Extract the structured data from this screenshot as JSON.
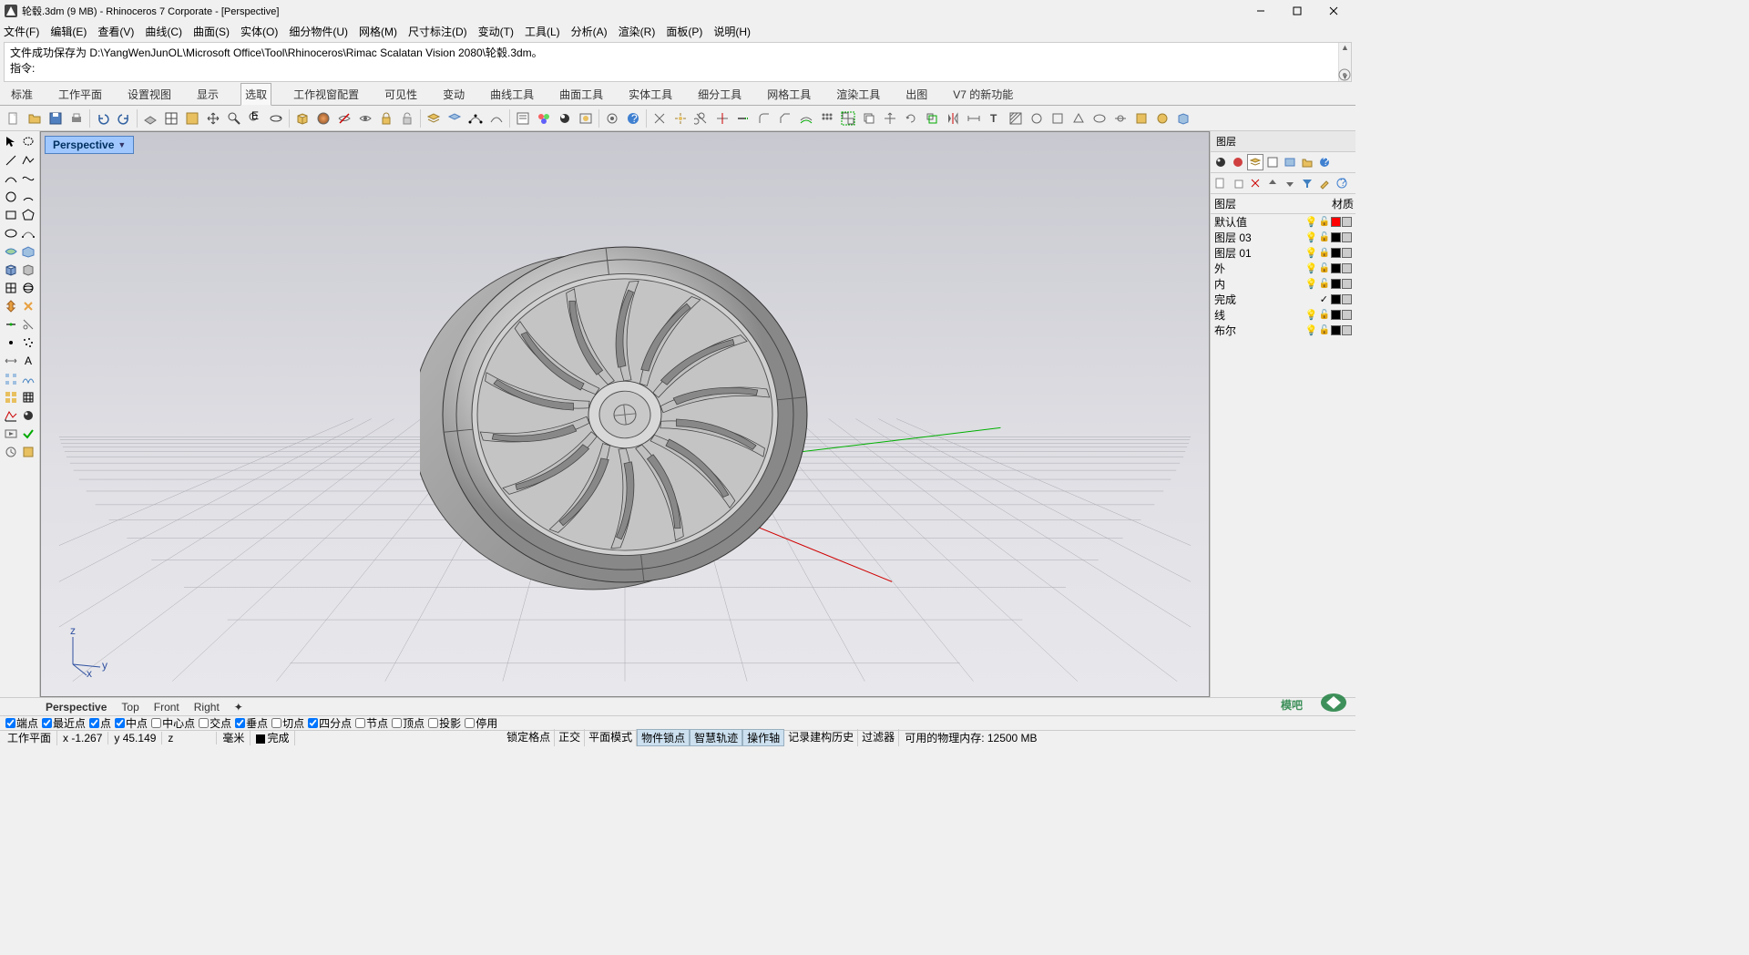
{
  "window": {
    "title": "轮毂.3dm (9 MB) - Rhinoceros 7 Corporate - [Perspective]"
  },
  "menu": [
    "文件(F)",
    "编辑(E)",
    "查看(V)",
    "曲线(C)",
    "曲面(S)",
    "实体(O)",
    "细分物件(U)",
    "网格(M)",
    "尺寸标注(D)",
    "变动(T)",
    "工具(L)",
    "分析(A)",
    "渲染(R)",
    "面板(P)",
    "说明(H)"
  ],
  "cmd": {
    "line1": "",
    "line2": "文件成功保存为 D:\\YangWenJunOL\\Microsoft Office\\Tool\\Rhinoceros\\Rimac Scalatan Vision 2080\\轮毂.3dm。",
    "prompt": "指令:"
  },
  "tabs": [
    "标准",
    "工作平面",
    "设置视图",
    "显示",
    "选取",
    "工作视窗配置",
    "可见性",
    "变动",
    "曲线工具",
    "曲面工具",
    "实体工具",
    "细分工具",
    "网格工具",
    "渲染工具",
    "出图",
    "V7 的新功能"
  ],
  "tabs_active": 4,
  "viewport": {
    "name": "Perspective"
  },
  "layerspanel": {
    "title": "图层",
    "header_name": "图层",
    "header_mat": "材质"
  },
  "layers": [
    {
      "name": "默认值",
      "on": true,
      "lock": true,
      "color": "#ff0000"
    },
    {
      "name": "图层 03",
      "on": true,
      "lock": true,
      "color": "#000000"
    },
    {
      "name": "图层 01",
      "on": true,
      "lock": true,
      "locked": true,
      "color": "#000000"
    },
    {
      "name": "外",
      "on": true,
      "lock": true,
      "color": "#000000"
    },
    {
      "name": "内",
      "on": true,
      "lock": true,
      "color": "#000000"
    },
    {
      "name": "完成",
      "check": true,
      "color": "#000000"
    },
    {
      "name": "线",
      "on": true,
      "lock": true,
      "color": "#000000"
    },
    {
      "name": "布尔",
      "on": true,
      "lock": true,
      "color": "#000000"
    }
  ],
  "viewtabs": [
    "Perspective",
    "Top",
    "Front",
    "Right"
  ],
  "viewtabs_active": 0,
  "osnaps": [
    {
      "label": "端点",
      "on": true
    },
    {
      "label": "最近点",
      "on": true
    },
    {
      "label": "点",
      "on": true
    },
    {
      "label": "中点",
      "on": true
    },
    {
      "label": "中心点",
      "on": false
    },
    {
      "label": "交点",
      "on": false
    },
    {
      "label": "垂点",
      "on": true
    },
    {
      "label": "切点",
      "on": false
    },
    {
      "label": "四分点",
      "on": true
    },
    {
      "label": "节点",
      "on": false
    },
    {
      "label": "顶点",
      "on": false
    },
    {
      "label": "投影",
      "on": false
    },
    {
      "label": "停用",
      "on": false
    }
  ],
  "status": {
    "pane": "工作平面",
    "x": "x -1.267",
    "y": "y 45.149",
    "z": "z",
    "unit": "毫米",
    "layer": "完成",
    "toggles": [
      "锁定格点",
      "正交",
      "平面模式",
      "物件锁点",
      "智慧轨迹",
      "操作轴",
      "记录建构历史",
      "过滤器"
    ],
    "toggles_on": [
      3,
      4,
      5
    ],
    "mem": "可用的物理内存: 12500 MB"
  },
  "watermark": "模吧"
}
